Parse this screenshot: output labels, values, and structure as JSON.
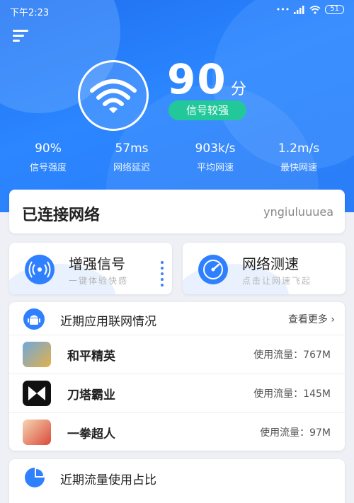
{
  "status_bar": {
    "time": "下午2:23",
    "battery": "51"
  },
  "score": {
    "value": "90",
    "unit": "分",
    "badge": "信号较强"
  },
  "stats": [
    {
      "value": "90%",
      "label": "信号强度"
    },
    {
      "value": "57ms",
      "label": "网络延迟"
    },
    {
      "value": "903k/s",
      "label": "平均网速"
    },
    {
      "value": "1.2m/s",
      "label": "最快网速"
    }
  ],
  "connection": {
    "title": "已连接网络",
    "ssid": "yngiuluuuea"
  },
  "actions": [
    {
      "title": "增强信号",
      "subtitle": "一键体验快感"
    },
    {
      "title": "网络测速",
      "subtitle": "点击让网速飞起"
    }
  ],
  "apps_section": {
    "title": "近期应用联网情况",
    "more": "查看更多",
    "items": [
      {
        "name": "和平精英",
        "usage": "使用流量：767M"
      },
      {
        "name": "刀塔霸业",
        "usage": "使用流量：145M"
      },
      {
        "name": "一拳超人",
        "usage": "使用流量：97M"
      }
    ]
  },
  "traffic_section": {
    "title": "近期流量使用占比"
  },
  "colors": {
    "primary": "#2f80ff",
    "badge_green": "#22c89a"
  }
}
